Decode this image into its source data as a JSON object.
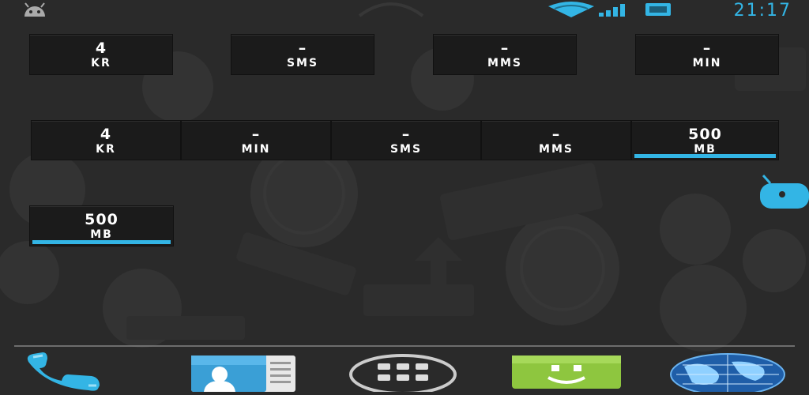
{
  "status_bar": {
    "time": "21:17",
    "icons": [
      "android-icon",
      "wifi-icon",
      "signal-icon",
      "battery-icon"
    ]
  },
  "widget_row1": [
    {
      "value": "4",
      "unit": "KR"
    },
    {
      "value": "–",
      "unit": "SMS"
    },
    {
      "value": "–",
      "unit": "MMS"
    },
    {
      "value": "–",
      "unit": "MIN"
    }
  ],
  "widget_row2": [
    {
      "value": "4",
      "unit": "KR"
    },
    {
      "value": "–",
      "unit": "MIN"
    },
    {
      "value": "–",
      "unit": "SMS"
    },
    {
      "value": "–",
      "unit": "MMS"
    },
    {
      "value": "500",
      "unit": "MB"
    }
  ],
  "widget_single": {
    "value": "500",
    "unit": "MB"
  },
  "dock": [
    "phone-icon",
    "contacts-icon",
    "app-drawer-icon",
    "messaging-icon",
    "browser-icon"
  ],
  "colors": {
    "accent": "#33b5e5",
    "tile_bg": "#1b1b1b",
    "wallpaper": "#2a2a2a",
    "messaging_green": "#8ec63f"
  }
}
